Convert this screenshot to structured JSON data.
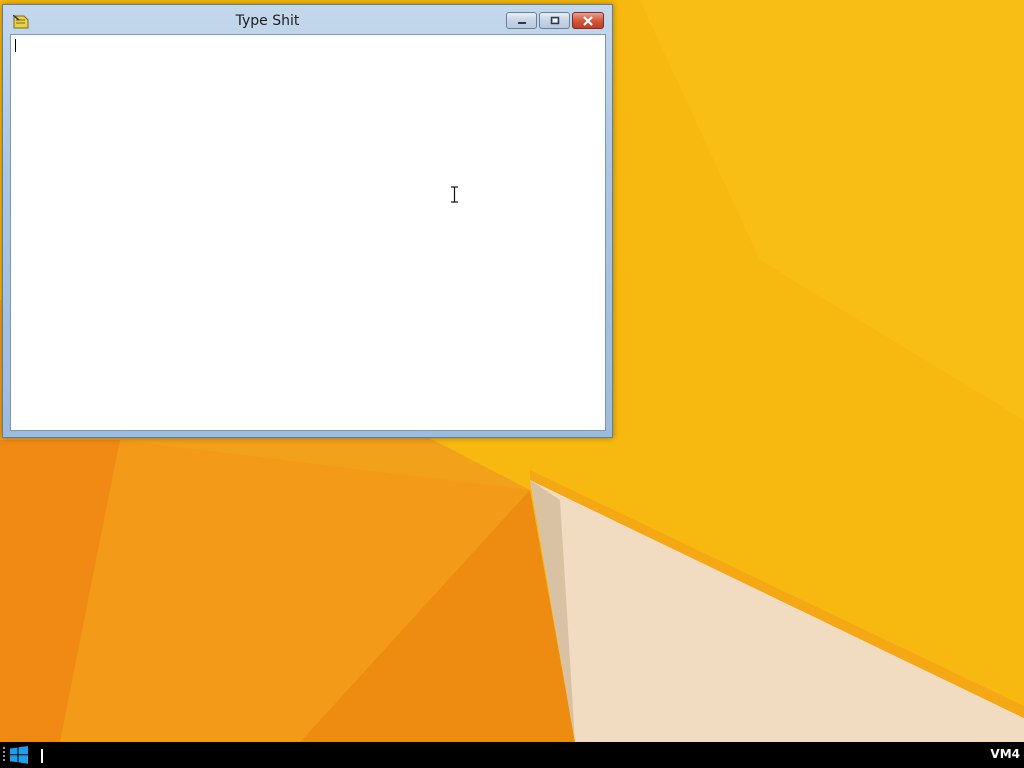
{
  "window": {
    "title": "Type Shit",
    "icon": "notepad-icon",
    "buttons": {
      "minimize": "minimize-icon",
      "maximize": "maximize-icon",
      "close": "close-icon"
    },
    "text_content": ""
  },
  "taskbar": {
    "start_icon": "windows-logo-icon",
    "label": "VM4"
  },
  "colors": {
    "wallpaper_base": "#f7b80f",
    "wallpaper_orange": "#f29a18",
    "wallpaper_light": "#f1dcc0",
    "taskbar": "#000000",
    "close_button": "#c94a30",
    "start_logo": "#1e9ee8"
  }
}
